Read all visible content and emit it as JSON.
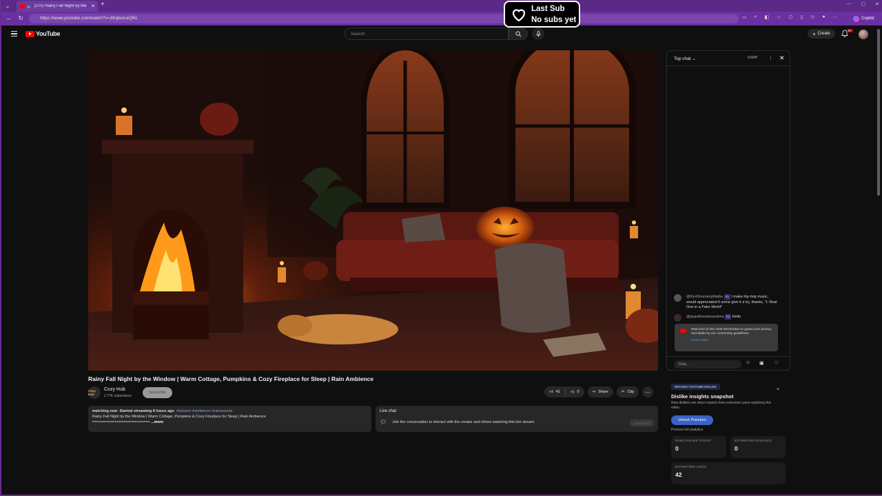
{
  "browser": {
    "tab_title": "(270) Rainy Fall Night by the",
    "url": "https://www.youtube.com/watch?v=3KqlsvLeQRc",
    "copilot_label": "Copilot"
  },
  "overlay": {
    "line1": "Last Sub",
    "line2": "No subs yet"
  },
  "youtube": {
    "logo_text": "YouTube",
    "search_placeholder": "Search",
    "create_label": "Create",
    "notification_count": "9+"
  },
  "video": {
    "title": "Rainy Fall Night by the Window | Warm Cottage, Pumpkins & Cozy Fireplace for Sleep | Rain Ambience",
    "channel_name": "Cozy Hub",
    "channel_avatar_text": "Cozy Hub",
    "subscribers": "2.77K subscribers",
    "subscribe_label": "Subscribe",
    "likes": "41",
    "dislikes": "0",
    "share_label": "Share",
    "clip_label": "Clip"
  },
  "description": {
    "watching": "watching now",
    "started": "Started streaming 8 hours ago",
    "tags": "#autumn #ambience #rainsounds",
    "line2": "Rainy Fall Night by the Window | Warm Cottage, Pumpkins & Cozy Fireplace for Sleep | Rain Ambience",
    "line3": "==========================",
    "more_label": "...more"
  },
  "live_chat_box": {
    "header": "Live chat",
    "text": "Join the conversation to interact with the creator and others watching this live stream.",
    "open_panel_label": "Open panel"
  },
  "chat": {
    "header": "Top chat",
    "xp": "0XP",
    "messages": [
      {
        "author": "@KyoShumanyMeibu",
        "badge": "#1",
        "text": "I make hip-hop music, would appreciated if some give it a try, thanks, \"L Real One in a Fake World\""
      },
      {
        "author": "@jaquellneslexandrea",
        "badge": "#2",
        "text": "Hello"
      }
    ],
    "welcome_text": "Welcome to live chat! Remember to guard your privacy and abide by our community guidelines.",
    "learn_more": "Learn more",
    "input_placeholder": "Chat..."
  },
  "ryd": {
    "tag": "RETURN YOUTUBE DISLIKE",
    "title": "Dislike insights snapshot",
    "subtitle": "Raw dislikes are direct reports from extension users watching this video.",
    "button": "Unlock Premium",
    "preview": "Preview full analytics",
    "raw_label": "RAW DISLIKE COUNT",
    "raw_value": "0",
    "est_dislikes_label": "ESTIMATED DISLIKES",
    "est_dislikes_value": "0",
    "est_likes_label": "ESTIMATED LIKES",
    "est_likes_value": "42"
  }
}
